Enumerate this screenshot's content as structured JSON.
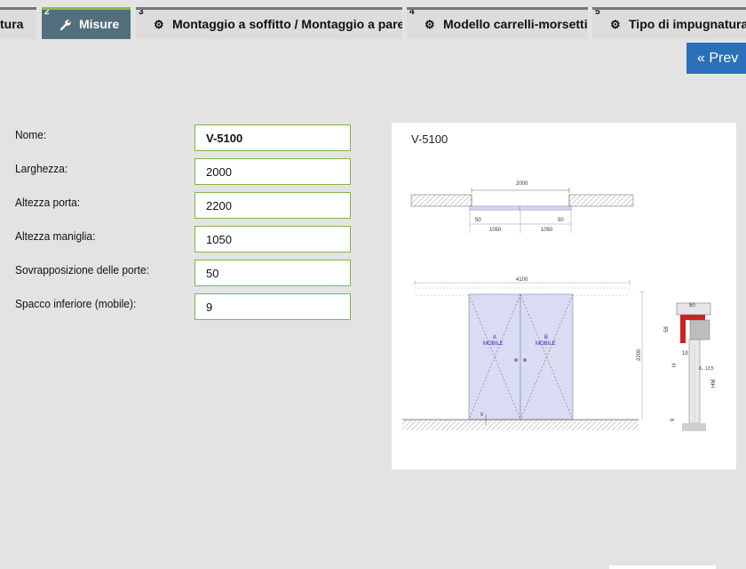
{
  "tabs": [
    {
      "num": "",
      "icon": "",
      "label": "tura",
      "active": false
    },
    {
      "num": "2",
      "icon": "wrench-icon",
      "label": "Misure",
      "active": true
    },
    {
      "num": "3",
      "icon": "gear-icon",
      "label": "Montaggio a soffitto / Montaggio a parete",
      "active": false
    },
    {
      "num": "4",
      "icon": "gear-icon",
      "label": "Modello carrelli-morsetti",
      "active": false
    },
    {
      "num": "5",
      "icon": "gear-icon",
      "label": "Tipo di impugnatura",
      "active": false
    }
  ],
  "prev_button": {
    "label": "« Prev"
  },
  "form": {
    "fields": [
      {
        "label": "Nome:",
        "value": "V-5100"
      },
      {
        "label": "Larghezza:",
        "value": "2000"
      },
      {
        "label": "Altezza porta:",
        "value": "2200"
      },
      {
        "label": "Altezza maniglia:",
        "value": "1050"
      },
      {
        "label": "Sovrapposizione delle porte:",
        "value": "50"
      },
      {
        "label": "Spacco inferiore (mobile):",
        "value": "9"
      }
    ]
  },
  "diagram": {
    "title": "V-5100",
    "top_view": {
      "width": "2000",
      "overlap_left": "50",
      "overlap_right": "50",
      "half_left": "1050",
      "half_right": "1050"
    },
    "front_view": {
      "total_width": "4100",
      "height": "2200",
      "gap": "9",
      "leaf_a": "A",
      "leaf_a_sub": "MOBILE",
      "leaf_b": "B",
      "leaf_b_sub": "MOBILE"
    },
    "section": {
      "top": "50",
      "rail": "58",
      "offset": "19",
      "h": "H",
      "hm": "HM",
      "handle": "8...13,5",
      "bottom": "9"
    }
  }
}
